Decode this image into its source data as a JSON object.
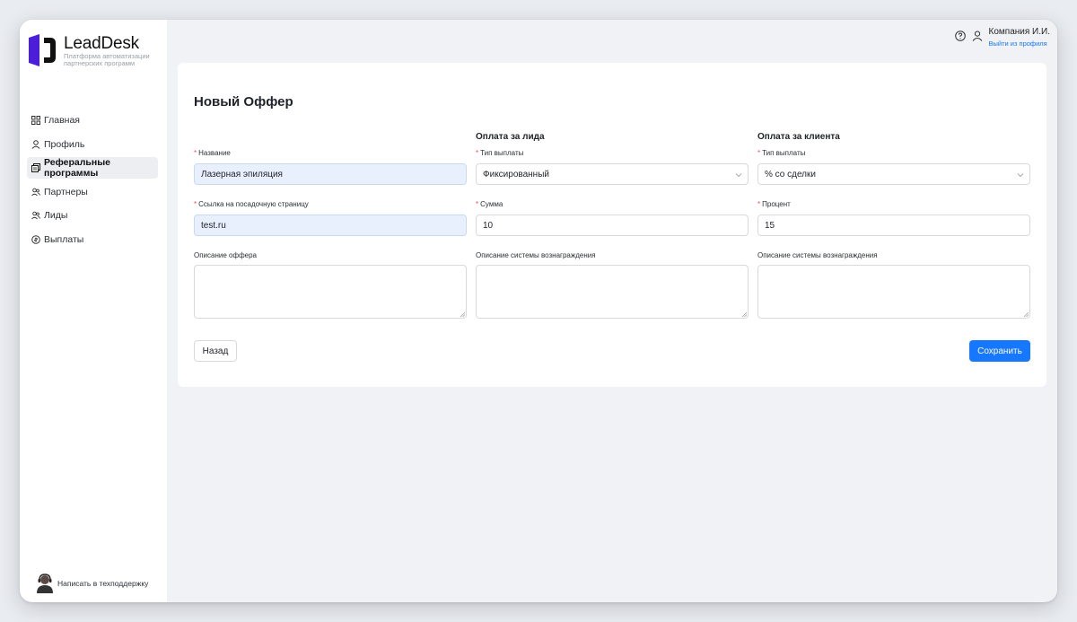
{
  "brand": {
    "name": "LeadDesk",
    "tagline": "Платформа автоматизации партнерских программ",
    "accent_color": "#4b1fd9"
  },
  "sidebar": {
    "items": [
      {
        "label": "Главная",
        "icon": "grid-icon",
        "active": false
      },
      {
        "label": "Профиль",
        "icon": "user-icon",
        "active": false
      },
      {
        "label": "Реферальные программы",
        "icon": "documents-icon",
        "active": true
      },
      {
        "label": "Партнеры",
        "icon": "users-icon",
        "active": false
      },
      {
        "label": "Лиды",
        "icon": "users-icon",
        "active": false
      },
      {
        "label": "Выплаты",
        "icon": "coin-icon",
        "active": false
      }
    ],
    "support_label": "Написать в техподдержку"
  },
  "header": {
    "user_name": "Компания И.И.",
    "logout_label": "Выйти из профиля"
  },
  "form": {
    "title": "Новый Оффер",
    "lead_section_title": "Оплата за лида",
    "client_section_title": "Оплата за клиента",
    "name": {
      "label": "Название",
      "value": "Лазерная эпиляция"
    },
    "landing": {
      "label": "Ссылка на посадочную страницу",
      "value": "test.ru"
    },
    "offer_description": {
      "label": "Описание оффера",
      "value": ""
    },
    "lead_payout_type": {
      "label": "Тип выплаты",
      "value": "Фиксированный"
    },
    "lead_amount": {
      "label": "Сумма",
      "value": "10"
    },
    "lead_reward_description": {
      "label": "Описание системы вознаграждения",
      "value": ""
    },
    "client_payout_type": {
      "label": "Тип выплаты",
      "value": "% со сделки"
    },
    "client_percent": {
      "label": "Процент",
      "value": "15"
    },
    "client_reward_description": {
      "label": "Описание системы вознаграждения",
      "value": ""
    },
    "back_label": "Назад",
    "save_label": "Сохранить"
  },
  "colors": {
    "primary": "#1677ff",
    "required": "#ff4d4f",
    "autofill_bg": "#e8f0fe"
  }
}
